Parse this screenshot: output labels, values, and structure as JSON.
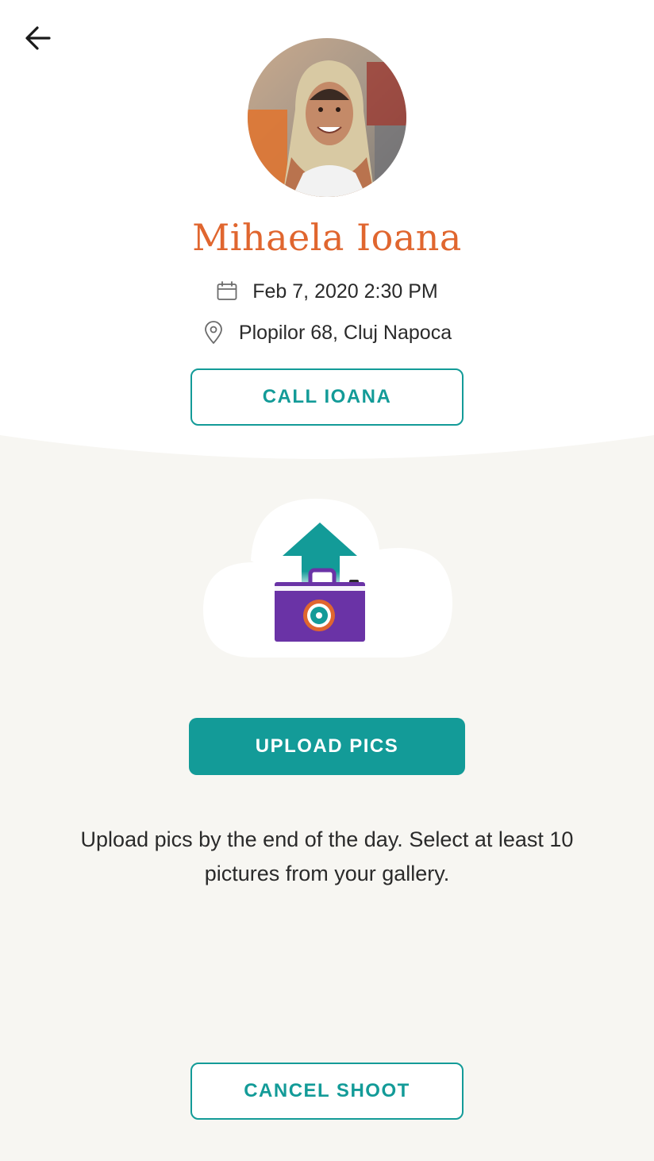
{
  "profile": {
    "name": "Mihaela Ioana",
    "date": "Feb 7, 2020 2:30 PM",
    "location": "Plopilor 68, Cluj Napoca"
  },
  "buttons": {
    "call": "CALL IOANA",
    "upload": "UPLOAD PICS",
    "cancel": "CANCEL SHOOT"
  },
  "hint": "Upload pics by the end of the day. Select at least 10 pictures from your gallery.",
  "icons": {
    "back": "arrow-left-icon",
    "date": "calendar-icon",
    "location": "map-pin-icon",
    "illustration": "cloud-upload-camera-icon"
  },
  "colors": {
    "accent": "#139b98",
    "name": "#e0662f",
    "background_lower": "#f7f6f2",
    "camera": "#6a33a6"
  }
}
